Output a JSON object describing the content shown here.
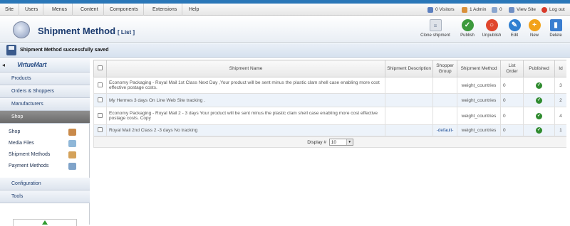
{
  "menubar": {
    "items": [
      "Site",
      "Users",
      "Menus",
      "Content",
      "Components",
      "Extensions",
      "Help"
    ],
    "status": {
      "visitors": "0 Visitors",
      "admins": "1 Admin",
      "messages": "0",
      "view_site": "View Site",
      "logout": "Log out"
    }
  },
  "toolbar": {
    "title": "Shipment Method",
    "subtitle": "[ List ]",
    "buttons": {
      "clone": "Clone shipment",
      "publish": "Publish",
      "unpublish": "Unpublish",
      "edit": "Edit",
      "new": "New",
      "delete": "Delete"
    }
  },
  "message": "Shipment Method successfully saved",
  "sidebar": {
    "logo": "VirtueMart",
    "sections": {
      "products": "Products",
      "orders": "Orders & Shoppers",
      "manufacturers": "Manufacturers",
      "shop": "Shop",
      "configuration": "Configuration",
      "tools": "Tools"
    },
    "shop_items": [
      "Shop",
      "Media Files",
      "Shipment Methods",
      "Payment Methods"
    ]
  },
  "table": {
    "headers": {
      "name": "Shipment Name",
      "description": "Shipment Description",
      "group": "Shopper Group",
      "method": "Shipment Method",
      "order": "List Order",
      "published": "Published",
      "id": "Id"
    },
    "rows": [
      {
        "name": "Economy Packaging - Royal Mail 1st Class Next Day ,Your product will be sent minus the plastic clam shell case enabling more cost effective postage costs.",
        "description": "",
        "group": "",
        "method": "weight_countries",
        "order": "0",
        "id": "3"
      },
      {
        "name": "My Hermes 3 days On Line Web Site tracking .",
        "description": "",
        "group": "",
        "method": "weight_countries",
        "order": "0",
        "id": "2"
      },
      {
        "name": "Economy Packaging - Royal Mail 2 - 3 days Your product will be sent minus the plastic clam shell case enabling more cost effective postage costs. Copy",
        "description": "",
        "group": "",
        "method": "weight_countries",
        "order": "0",
        "id": "4"
      },
      {
        "name": "Royal Mail 2nd Class 2 -3 days No tracking",
        "description": "",
        "group": "-default-",
        "method": "weight_countries",
        "order": "0",
        "id": "1"
      }
    ]
  },
  "pager": {
    "label": "Display #",
    "value": "10"
  },
  "colors": {
    "accent": "#2a77b8",
    "title": "#1a3a6e",
    "link": "#1f4f97",
    "published_green": "#2f8b2f"
  }
}
